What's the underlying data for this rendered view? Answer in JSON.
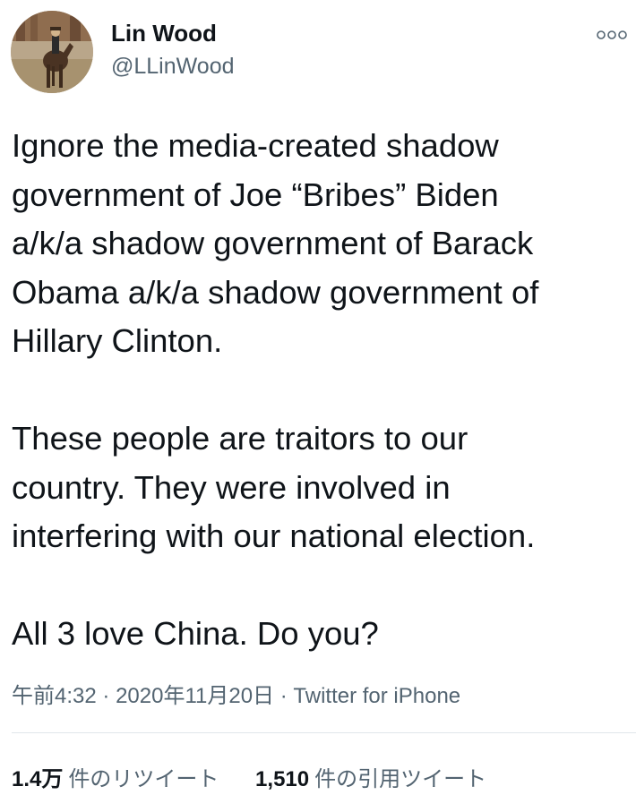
{
  "author": {
    "display_name": "Lin Wood",
    "handle": "@LLinWood",
    "avatar_icon": "horse-rider-avatar"
  },
  "more_icon": "ellipsis-icon",
  "tweet": {
    "text": "Ignore the media-created shadow\ngovernment of Joe “Bribes” Biden\na/k/a shadow government of Barack\nObama a/k/a shadow government of\nHillary Clinton.\n\nThese people are traitors to our\ncountry. They were involved in\ninterfering with our national election.\n\nAll 3 love China. Do you?"
  },
  "meta": {
    "time": "午前4:32",
    "separator": "·",
    "date": "2020年11月20日",
    "source": "Twitter for iPhone"
  },
  "stats": {
    "retweets_count": "1.4万",
    "retweets_label": "件のリツイート",
    "quotes_count": "1,510",
    "quotes_label": "件の引用ツイート"
  },
  "colors": {
    "text_primary": "#0f1419",
    "text_secondary": "#536471",
    "divider": "#e1e6ea"
  }
}
